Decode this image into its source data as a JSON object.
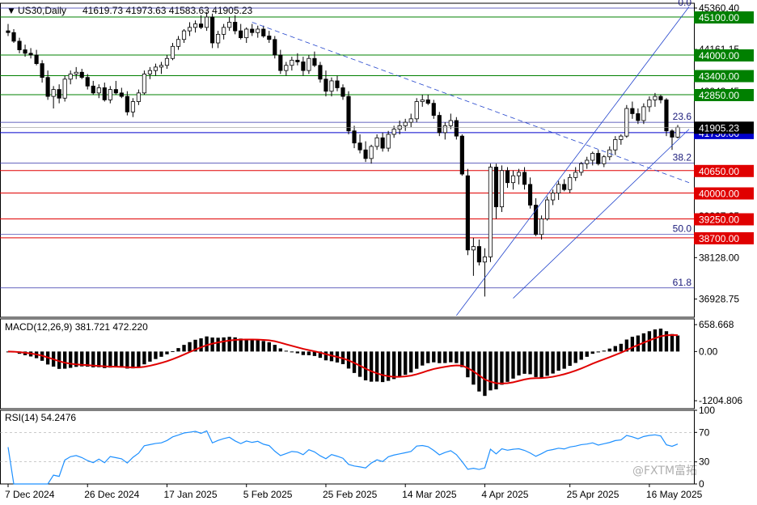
{
  "chart_data": {
    "type": "candlestick",
    "symbol_line": "US30,Daily",
    "ohlc_line": "41619.73 41973.63 41583.63 41905.23",
    "price_axis": {
      "ylim": [
        36400,
        45500
      ],
      "tick_labels": [
        {
          "v": 45360.4,
          "text": "45360.40"
        },
        {
          "v": 44161.15,
          "text": "44161.15"
        },
        {
          "v": 42943.45,
          "text": "42943.45"
        },
        {
          "v": 39327.25,
          "text": "39327.25"
        },
        {
          "v": 38128.0,
          "text": "38128.00"
        },
        {
          "v": 36928.75,
          "text": "36928.75"
        }
      ]
    },
    "current_price": {
      "value": 41905.23,
      "text": "41905.23"
    },
    "resistance_levels": [
      {
        "value": 45100,
        "text": "45100.00",
        "color": "#008000"
      },
      {
        "value": 44000,
        "text": "44000.00",
        "color": "#008000"
      },
      {
        "value": 43400,
        "text": "43400.00",
        "color": "#008000"
      },
      {
        "value": 42850,
        "text": "42850.00",
        "color": "#008000"
      }
    ],
    "pivot_level": {
      "value": 41750,
      "text": "41750.00",
      "color": "#0000cc"
    },
    "support_levels": [
      {
        "value": 40650,
        "text": "40650.00",
        "color": "#e00000"
      },
      {
        "value": 40000,
        "text": "40000.00",
        "color": "#e00000"
      },
      {
        "value": 39250,
        "text": "39250.00",
        "color": "#e00000"
      },
      {
        "value": 38700,
        "text": "38700.00",
        "color": "#e00000"
      }
    ],
    "fibonacci": [
      {
        "label": "0.0",
        "value": 45360
      },
      {
        "label": "23.6",
        "value": 42050
      },
      {
        "label": "38.2",
        "value": 40870
      },
      {
        "label": "50.0",
        "value": 38800
      },
      {
        "label": "61.8",
        "value": 37250
      }
    ],
    "x_labels": [
      "7 Dec 2024",
      "26 Dec 2024",
      "17 Jan 2025",
      "5 Feb 2025",
      "25 Feb 2025",
      "14 Mar 2025",
      "4 Apr 2025",
      "25 Apr 2025",
      "16 May 2025"
    ],
    "candles": [
      [
        44700,
        44900,
        44550,
        44650
      ],
      [
        44650,
        44750,
        44350,
        44400
      ],
      [
        44400,
        44500,
        44050,
        44150
      ],
      [
        44150,
        44300,
        43950,
        44050
      ],
      [
        44050,
        44200,
        43900,
        44000
      ],
      [
        44000,
        44150,
        43700,
        43750
      ],
      [
        43750,
        43850,
        43200,
        43350
      ],
      [
        43350,
        43550,
        42700,
        42800
      ],
      [
        42800,
        43100,
        42450,
        43000
      ],
      [
        43000,
        43150,
        42600,
        42750
      ],
      [
        42750,
        43400,
        42650,
        43300
      ],
      [
        43300,
        43550,
        43150,
        43450
      ],
      [
        43450,
        43650,
        43300,
        43500
      ],
      [
        43500,
        43600,
        43300,
        43350
      ],
      [
        43350,
        43450,
        43000,
        43100
      ],
      [
        43100,
        43250,
        42850,
        42900
      ],
      [
        42900,
        43150,
        42750,
        43050
      ],
      [
        43050,
        43200,
        42650,
        42700
      ],
      [
        42700,
        43100,
        42600,
        43000
      ],
      [
        43000,
        43250,
        42850,
        42900
      ],
      [
        42900,
        43050,
        42750,
        42800
      ],
      [
        42800,
        42950,
        42250,
        42350
      ],
      [
        42350,
        42750,
        42200,
        42650
      ],
      [
        42650,
        43000,
        42550,
        42900
      ],
      [
        42900,
        43550,
        42850,
        43450
      ],
      [
        43450,
        43650,
        43300,
        43550
      ],
      [
        43550,
        43750,
        43400,
        43650
      ],
      [
        43650,
        43800,
        43450,
        43700
      ],
      [
        43700,
        44000,
        43600,
        43900
      ],
      [
        43900,
        44350,
        43850,
        44250
      ],
      [
        44250,
        44550,
        44150,
        44450
      ],
      [
        44450,
        44750,
        44350,
        44700
      ],
      [
        44700,
        44950,
        44550,
        44800
      ],
      [
        44800,
        45000,
        44650,
        44900
      ],
      [
        44900,
        45150,
        44750,
        44800
      ],
      [
        44800,
        45250,
        44700,
        45100
      ],
      [
        45100,
        45200,
        44200,
        44350
      ],
      [
        44350,
        44700,
        44200,
        44600
      ],
      [
        44600,
        44900,
        44450,
        44800
      ],
      [
        44800,
        45100,
        44700,
        44950
      ],
      [
        44950,
        45150,
        44600,
        44700
      ],
      [
        44700,
        44900,
        44450,
        44500
      ],
      [
        44500,
        44800,
        44350,
        44750
      ],
      [
        44750,
        44900,
        44550,
        44650
      ],
      [
        44650,
        44850,
        44500,
        44750
      ],
      [
        44750,
        44850,
        44500,
        44550
      ],
      [
        44550,
        44700,
        44350,
        44450
      ],
      [
        44450,
        44550,
        43900,
        44000
      ],
      [
        44000,
        44150,
        43450,
        43550
      ],
      [
        43550,
        43800,
        43400,
        43700
      ],
      [
        43700,
        43950,
        43550,
        43850
      ],
      [
        43850,
        44050,
        43700,
        43800
      ],
      [
        43800,
        43950,
        43400,
        43550
      ],
      [
        43550,
        44000,
        43450,
        43900
      ],
      [
        43900,
        44100,
        43650,
        43700
      ],
      [
        43700,
        43800,
        43200,
        43300
      ],
      [
        43300,
        43550,
        42800,
        42950
      ],
      [
        42950,
        43350,
        42800,
        43250
      ],
      [
        43250,
        43400,
        42950,
        43050
      ],
      [
        43050,
        43150,
        42700,
        42800
      ],
      [
        42800,
        42950,
        41700,
        41800
      ],
      [
        41800,
        41950,
        41300,
        41450
      ],
      [
        41450,
        41700,
        41150,
        41250
      ],
      [
        41250,
        41500,
        40900,
        41000
      ],
      [
        41000,
        41400,
        40850,
        41350
      ],
      [
        41350,
        41700,
        41250,
        41600
      ],
      [
        41600,
        41750,
        41200,
        41300
      ],
      [
        41300,
        41800,
        41200,
        41700
      ],
      [
        41700,
        41950,
        41600,
        41850
      ],
      [
        41850,
        42100,
        41700,
        41950
      ],
      [
        41950,
        42150,
        41800,
        42050
      ],
      [
        42050,
        42300,
        41900,
        42150
      ],
      [
        42150,
        42750,
        42050,
        42650
      ],
      [
        42650,
        42850,
        42500,
        42700
      ],
      [
        42700,
        42850,
        42550,
        42600
      ],
      [
        42600,
        42700,
        42150,
        42250
      ],
      [
        42250,
        42350,
        41650,
        41750
      ],
      [
        41750,
        42050,
        41550,
        41950
      ],
      [
        41950,
        42300,
        41850,
        42100
      ],
      [
        42100,
        42200,
        41550,
        41650
      ],
      [
        41650,
        41700,
        40500,
        40550
      ],
      [
        40500,
        40700,
        38200,
        38350
      ],
      [
        38350,
        38700,
        37600,
        38450
      ],
      [
        38450,
        38650,
        37900,
        38000
      ],
      [
        38000,
        38400,
        37000,
        38150
      ],
      [
        38150,
        40850,
        38000,
        40750
      ],
      [
        40750,
        40850,
        39250,
        39600
      ],
      [
        39600,
        40800,
        39450,
        40650
      ],
      [
        40650,
        40750,
        40150,
        40300
      ],
      [
        40300,
        40650,
        40100,
        40500
      ],
      [
        40500,
        40700,
        40250,
        40600
      ],
      [
        40600,
        40750,
        40100,
        40250
      ],
      [
        40250,
        40450,
        39550,
        39650
      ],
      [
        39650,
        39850,
        38750,
        38800
      ],
      [
        38800,
        39350,
        38650,
        39250
      ],
      [
        39250,
        39900,
        39200,
        39800
      ],
      [
        39800,
        40100,
        39650,
        40000
      ],
      [
        40000,
        40350,
        39800,
        40250
      ],
      [
        40250,
        40400,
        40050,
        40100
      ],
      [
        40100,
        40550,
        40000,
        40450
      ],
      [
        40450,
        40750,
        40350,
        40600
      ],
      [
        40600,
        40900,
        40500,
        40850
      ],
      [
        40850,
        41050,
        40700,
        40950
      ],
      [
        40950,
        41200,
        40800,
        41150
      ],
      [
        41150,
        41250,
        40800,
        40850
      ],
      [
        40850,
        41100,
        40750,
        41050
      ],
      [
        41050,
        41350,
        40950,
        41250
      ],
      [
        41250,
        41650,
        41100,
        41550
      ],
      [
        41550,
        41700,
        41400,
        41650
      ],
      [
        41650,
        42550,
        41600,
        42450
      ],
      [
        42450,
        42650,
        42150,
        42300
      ],
      [
        42300,
        42450,
        42000,
        42100
      ],
      [
        42100,
        42600,
        42000,
        42500
      ],
      [
        42500,
        42800,
        42350,
        42700
      ],
      [
        42700,
        42900,
        42500,
        42800
      ],
      [
        42800,
        42850,
        42600,
        42700
      ],
      [
        42700,
        42750,
        41650,
        41800
      ],
      [
        41800,
        41850,
        41250,
        41620
      ],
      [
        41619.73,
        41973.63,
        41583.63,
        41905.23
      ]
    ],
    "macd": {
      "label": "MACD(12,26,9) 381.721 472.220",
      "ylim": [
        -1400,
        800
      ],
      "tick_labels": [
        {
          "v": 658.668,
          "text": "658.668"
        },
        {
          "v": 0,
          "text": "0.00"
        },
        {
          "v": -1204.806,
          "text": "-1204.806"
        }
      ],
      "signal_color": "#e00000"
    },
    "rsi": {
      "label": "RSI(14) 54.2476",
      "ylim": [
        0,
        100
      ],
      "tick_labels": [
        {
          "v": 100,
          "text": "100"
        },
        {
          "v": 70,
          "text": "70"
        },
        {
          "v": 30,
          "text": "30"
        },
        {
          "v": 0,
          "text": "0"
        }
      ],
      "line_color": "#1e90ff"
    },
    "colors": {
      "bull_body": "#ffffff",
      "bear_body": "#000000",
      "wick": "#000000",
      "current_price_box": "#000000"
    }
  },
  "watermark": "@FXTM富拓"
}
